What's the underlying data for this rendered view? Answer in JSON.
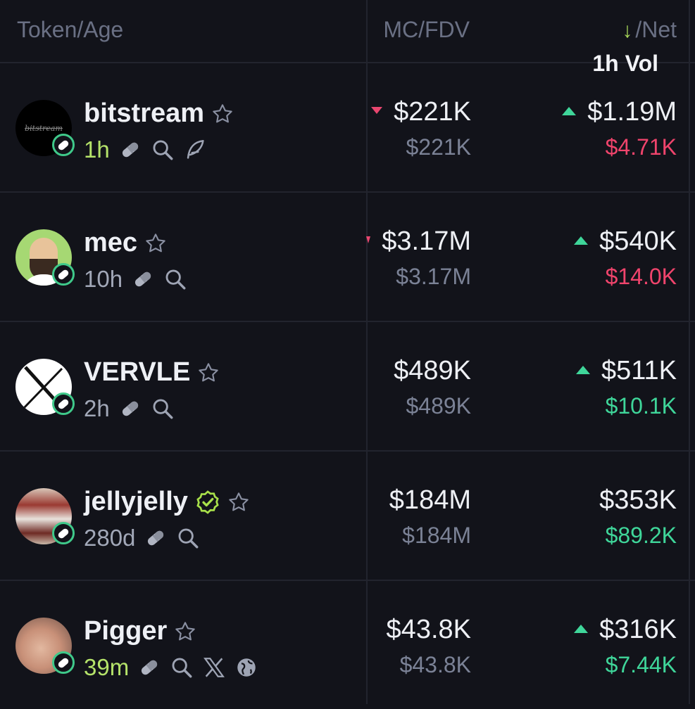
{
  "header": {
    "token_age": "Token/Age",
    "mc_fdv": "MC/FDV",
    "sort_arrow": "↓",
    "vol_label": "1h Vol",
    "net_label": "/Net"
  },
  "colors": {
    "background": "#12131a",
    "positive": "#3fd69a",
    "negative": "#f0446c",
    "new_age": "#b5e36a",
    "muted": "#7b8296"
  },
  "rows": [
    {
      "name": "bitstream",
      "avatar_text": "bitstream",
      "age": "1h",
      "mc": "$221K",
      "fdv": "$221K",
      "vol": "$1.19M",
      "net": "$4.71K",
      "net_direction": "negative",
      "icons": [
        "pill-icon",
        "search-icon",
        "feather-icon"
      ]
    },
    {
      "name": "mec",
      "age": "10h",
      "mc": "$3.17M",
      "fdv": "$3.17M",
      "vol": "$540K",
      "net": "$14.0K",
      "net_direction": "negative",
      "icons": [
        "pill-icon",
        "search-icon"
      ]
    },
    {
      "name": "VERVLE",
      "age": "2h",
      "mc": "$489K",
      "fdv": "$489K",
      "vol": "$511K",
      "net": "$10.1K",
      "net_direction": "positive",
      "icons": [
        "pill-icon",
        "search-icon"
      ]
    },
    {
      "name": "jellyjelly",
      "age": "280d",
      "mc": "$184M",
      "fdv": "$184M",
      "vol": "$353K",
      "net": "$89.2K",
      "net_direction": "positive",
      "verified": true,
      "icons": [
        "pill-icon",
        "search-icon"
      ]
    },
    {
      "name": "Pigger",
      "age": "39m",
      "mc": "$43.8K",
      "fdv": "$43.8K",
      "vol": "$316K",
      "net": "$7.44K",
      "net_direction": "positive",
      "icons": [
        "pill-icon",
        "search-icon",
        "x-icon",
        "globe-icon"
      ]
    }
  ]
}
